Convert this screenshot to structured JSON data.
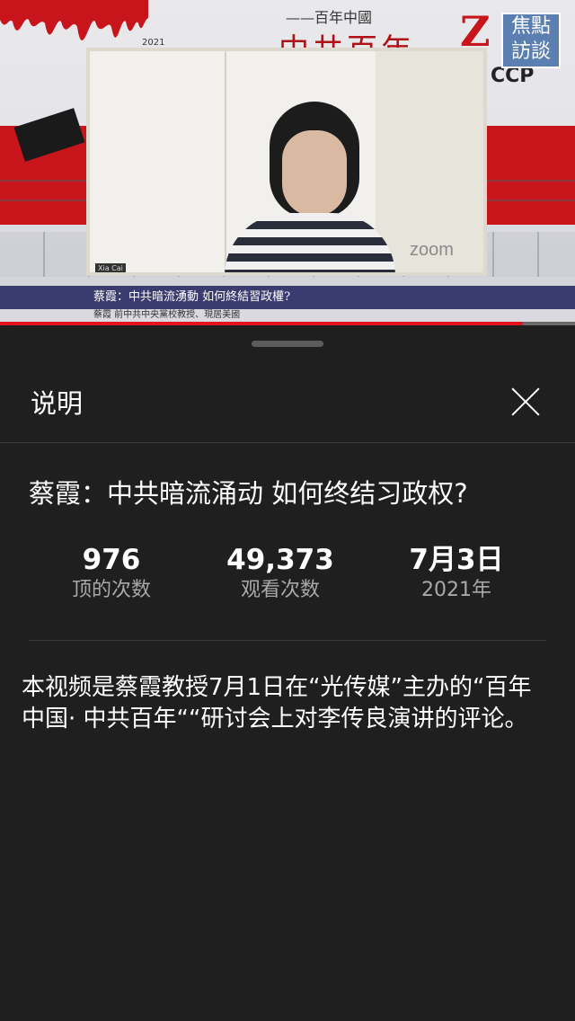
{
  "video": {
    "series_title": "——百年中國",
    "overlay_red_text": "中共百年",
    "brand_logo": "焦點訪談",
    "ccp_letters": "CCP",
    "year_small": "2021",
    "zoom_watermark": "zoom",
    "participant_name": "Xia Cai",
    "lower_third_title": "蔡霞：中共暗流湧動 如何終結習政權?",
    "lower_third_subtitle": "蔡霞 前中共中央黨校教授、現居美國",
    "progress_fraction": 0.91,
    "accent_color": "#e5111c"
  },
  "panel": {
    "header_title": "说明",
    "close_icon": "close-icon",
    "video_title": "蔡霞：中共暗流涌动 如何终结习政权?",
    "stats": [
      {
        "value": "976",
        "label": "顶的次数"
      },
      {
        "value": "49,373",
        "label": "观看次数"
      },
      {
        "value": "7月3日",
        "label": "2021年"
      }
    ],
    "description": "本视频是蔡霞教授7月1日在“光传媒”主办的“百年中国· 中共百年““研讨会上对李传良演讲的评论。"
  }
}
